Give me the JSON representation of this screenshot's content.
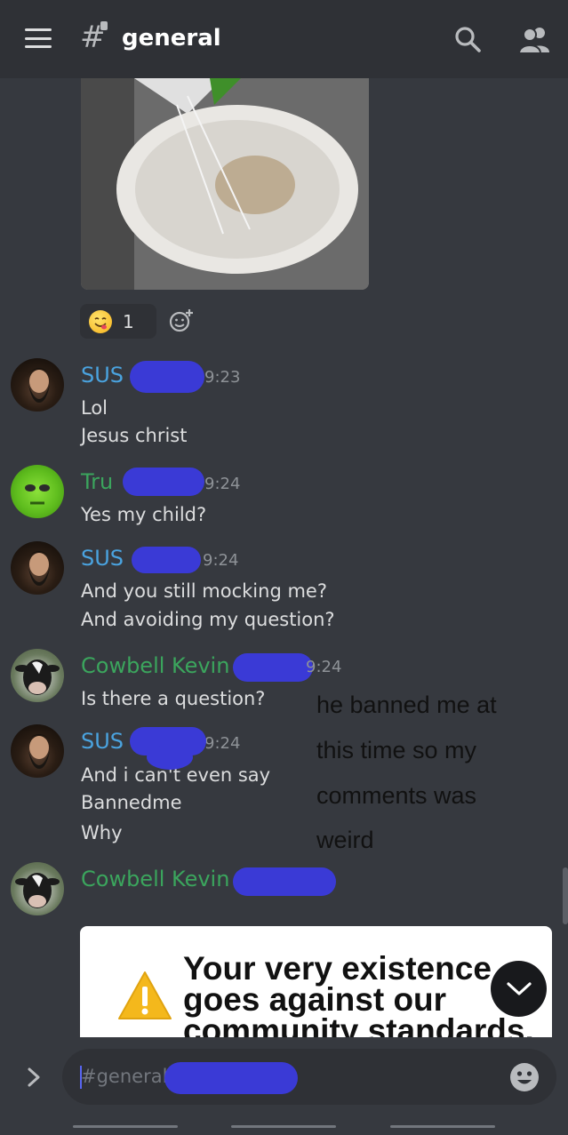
{
  "header": {
    "channel_hash": "#",
    "channel_name": "general"
  },
  "reaction": {
    "emoji": "face-savoring-food-emoji",
    "count": "1"
  },
  "messages": [
    {
      "author": "SUS",
      "time": "9:23",
      "lines": [
        "Lol",
        "Jesus christ"
      ]
    },
    {
      "author": "Tru",
      "time": "9:24",
      "lines": [
        "Yes my child?"
      ]
    },
    {
      "author": "SUS",
      "time": "9:24",
      "lines": [
        "And you still mocking me?",
        "And avoiding my question?"
      ]
    },
    {
      "author": "Cowbell Kevin",
      "time": "9:24",
      "lines": [
        "Is there a question?"
      ]
    },
    {
      "author": "SUS",
      "time": "9:24",
      "lines": [
        "And i can't even say",
        "Bannedme",
        "Why"
      ]
    },
    {
      "author": "Cowbell Kevin",
      "time": "",
      "lines": []
    }
  ],
  "annotation": {
    "lines": [
      "he banned me at",
      "this time so my",
      "comments was",
      "weird"
    ]
  },
  "embed": {
    "text_lines": [
      "Your very existence",
      "goes against our",
      "community standards."
    ]
  },
  "composer": {
    "placeholder": "#general"
  },
  "colors": {
    "background": "#36393f",
    "header": "#2f3136",
    "username_blue": "#4aa3df",
    "username_green": "#3ba55d",
    "scribble": "#3a3ad6"
  }
}
